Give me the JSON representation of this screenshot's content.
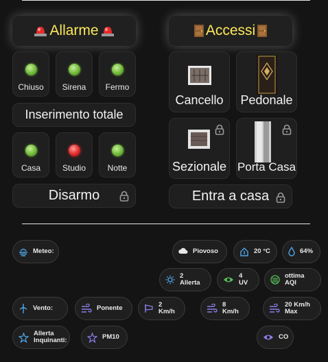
{
  "allarme": {
    "title": "Allarme",
    "modes": [
      {
        "label": "Chiuso",
        "state": "on"
      },
      {
        "label": "Sirena",
        "state": "on"
      },
      {
        "label": "Fermo",
        "state": "on"
      }
    ],
    "insert_label": "Inserimento totale",
    "zones": [
      {
        "label": "Casa",
        "state": "on"
      },
      {
        "label": "Studio",
        "state": "alarm"
      },
      {
        "label": "Notte",
        "state": "on"
      }
    ],
    "disarm_label": "Disarmo"
  },
  "accessi": {
    "title": "Accessi",
    "doors": [
      {
        "label": "Cancello"
      },
      {
        "label": "Pedonale"
      },
      {
        "label": "Sezionale"
      },
      {
        "label": "Porta Casa"
      }
    ],
    "enter_label": "Entra a casa"
  },
  "weather": {
    "meteo_label": "Meteo:",
    "condition": "Piovoso",
    "temperature": "20 °C",
    "humidity": "64%",
    "alert": "2 Allerta",
    "uv": "4 UV",
    "aqi": "ottima AQI",
    "wind_label": "Vento:",
    "wind_dir": "Ponente",
    "wind_speed1": "2 Km/h",
    "wind_speed2": "8 Km/h",
    "wind_max_line1": "20 Km/h",
    "wind_max_line2": "Max",
    "pollution_line1": "Allerta",
    "pollution_line2": "Inquinanti:",
    "pm10": "PM10",
    "co": "CO"
  },
  "colors": {
    "title_text": "#fbe85a",
    "accent_blue": "#4ea6e8",
    "accent_purple": "#8a7ee8",
    "accent_green": "#57c05b",
    "led_green": "#6fb838",
    "led_red": "#e02a2a"
  }
}
